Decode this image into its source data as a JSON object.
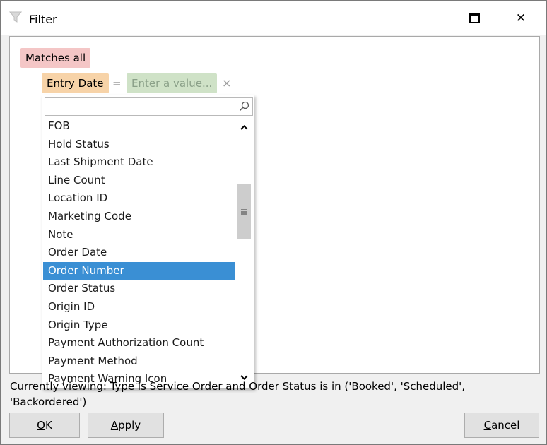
{
  "window": {
    "title": "Filter",
    "icon": "funnel-icon"
  },
  "filter": {
    "group_label": "Matches all",
    "field_label": "Entry Date",
    "operator": "=",
    "value_placeholder": "Enter a value...",
    "remove_symbol": "×"
  },
  "dropdown": {
    "search_value": "",
    "items": [
      "FOB",
      "Hold Status",
      "Last Shipment Date",
      "Line Count",
      "Location ID",
      "Marketing Code",
      "Note",
      "Order Date",
      "Order Number",
      "Order Status",
      "Origin ID",
      "Origin Type",
      "Payment Authorization Count",
      "Payment Method",
      "Payment Warning Icon"
    ],
    "selected_index": 8,
    "scroll_position": 0.38
  },
  "status": {
    "text": "Currently viewing: Type is Service Order and Order Status is in ('Booked', 'Scheduled', 'Backordered')"
  },
  "buttons": {
    "ok_mnemonic": "O",
    "ok_rest": "K",
    "apply_mnemonic": "A",
    "apply_rest": "pply",
    "cancel_mnemonic": "C",
    "cancel_rest": "ancel"
  },
  "colors": {
    "group_chip": "#f4c6c6",
    "field_chip": "#f7d3a8",
    "value_chip": "#cfe2c7",
    "selection": "#3a8fd4"
  }
}
